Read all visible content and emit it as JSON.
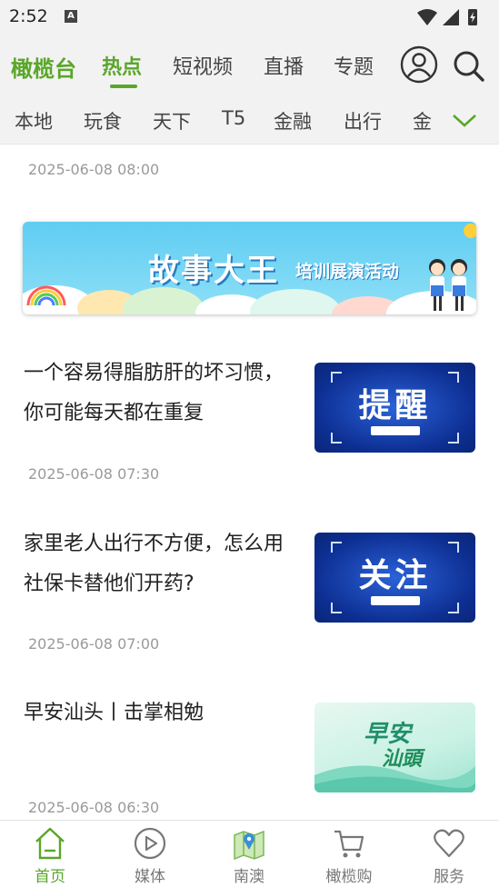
{
  "status_bar": {
    "time": "2:52",
    "notification_icon": "A"
  },
  "header": {
    "brand": "橄榄台",
    "tabs": [
      "热点",
      "短视频",
      "直播",
      "专题"
    ],
    "active_tab": "热点",
    "accent_color": "#5aa629"
  },
  "categories": [
    "本地",
    "玩食",
    "天下",
    "T5",
    "金融",
    "出行",
    "金"
  ],
  "feed": {
    "top_date": "2025-06-08 08:00",
    "banner": {
      "title": "故事大王",
      "subtitle": "培训展演活动"
    },
    "articles": [
      {
        "title": "一个容易得脂肪肝的坏习惯，你可能每天都在重复",
        "date": "2025-06-08 07:30",
        "thumb_text": "提醒",
        "thumb_style": "blue"
      },
      {
        "title": "家里老人出行不方便，怎么用社保卡替他们开药?",
        "date": "2025-06-08 07:00",
        "thumb_text": "关注",
        "thumb_style": "blue"
      },
      {
        "title": "早安汕头丨击掌相勉",
        "date": "2025-06-08 06:30",
        "thumb_text": "早安",
        "thumb_sub": "汕頭",
        "thumb_style": "green"
      }
    ]
  },
  "bottom_nav": [
    {
      "label": "首页",
      "icon": "home-icon",
      "active": true
    },
    {
      "label": "媒体",
      "icon": "play-circle-icon",
      "active": false
    },
    {
      "label": "南澳",
      "icon": "map-icon",
      "active": false
    },
    {
      "label": "橄榄购",
      "icon": "cart-icon",
      "active": false
    },
    {
      "label": "服务",
      "icon": "heart-icon",
      "active": false
    }
  ]
}
